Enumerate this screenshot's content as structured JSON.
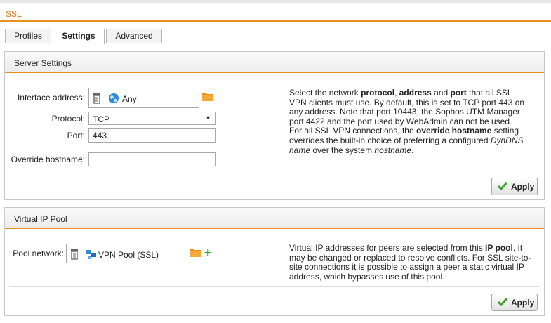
{
  "page": {
    "title": "SSL"
  },
  "tabs": [
    {
      "label": "Profiles",
      "active": false
    },
    {
      "label": "Settings",
      "active": true
    },
    {
      "label": "Advanced",
      "active": false
    }
  ],
  "server_settings": {
    "header": "Server Settings",
    "interface_label": "Interface address:",
    "interface_value": "Any",
    "protocol_label": "Protocol:",
    "protocol_value": "TCP",
    "port_label": "Port:",
    "port_value": "443",
    "override_label": "Override hostname:",
    "override_value": "",
    "help": {
      "p1": "Select the network ",
      "b1": "protocol",
      "p2": ", ",
      "b2": "address",
      "p3": " and ",
      "b3": "port",
      "p4": " that all SSL VPN clients must use. By default, this is set to TCP port 443 on any address. Note that port 10443, the Sophos UTM Manager port 4422 and the port used by WebAdmin can not be used.",
      "p5": "For all SSL VPN connections, the ",
      "b4": "override hostname",
      "p6": " setting overrides the built-in choice of preferring a configured ",
      "i1": "DynDNS name",
      "p7": " over the system ",
      "i2": "hostname",
      "p8": "."
    },
    "apply_label": "Apply"
  },
  "virtual_ip_pool": {
    "header": "Virtual IP Pool",
    "pool_label": "Pool network:",
    "pool_value": "VPN Pool (SSL)",
    "help": {
      "p1": "Virtual IP addresses for peers are selected from this ",
      "b1": "IP pool",
      "p2": ". It may be changed or replaced to resolve conflicts. For SSL site-to-site connections it is possible to assign a peer a static virtual IP address, which bypasses use of this pool."
    },
    "apply_label": "Apply"
  },
  "colors": {
    "accent": "#e8901c",
    "title_text": "#e0781a",
    "apply_check": "#3aa02a"
  },
  "icons": [
    "trash-icon",
    "globe-icon",
    "network-icon",
    "folder-icon",
    "plus-icon",
    "check-icon"
  ]
}
